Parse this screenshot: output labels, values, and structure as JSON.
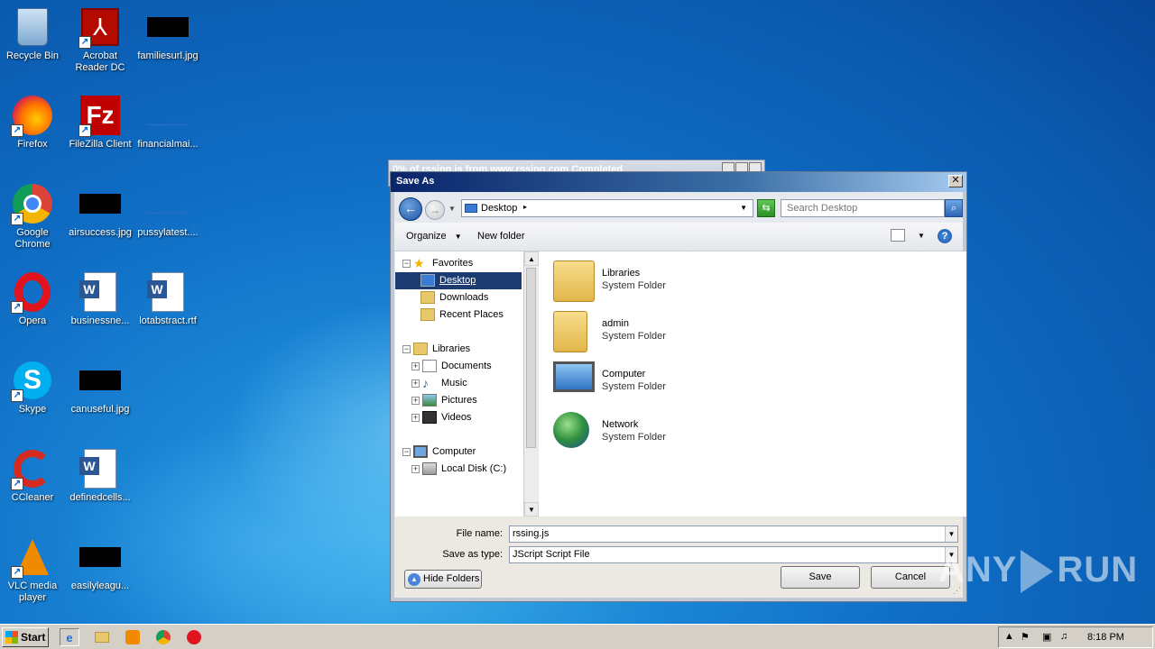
{
  "desktop": {
    "icons": [
      {
        "label": "Recycle Bin",
        "icon": "recycle-bin-icon"
      },
      {
        "label": "Acrobat Reader DC",
        "icon": "acrobat-icon"
      },
      {
        "label": "familiesurl.jpg",
        "icon": "image-file-icon"
      },
      {
        "label": "Firefox",
        "icon": "firefox-icon"
      },
      {
        "label": "FileZilla Client",
        "icon": "filezilla-icon"
      },
      {
        "label": "financialmai...",
        "icon": "image-file-icon"
      },
      {
        "label": "Google Chrome",
        "icon": "chrome-icon"
      },
      {
        "label": "airsuccess.jpg",
        "icon": "image-file-icon"
      },
      {
        "label": "pussylatest....",
        "icon": "image-file-icon"
      },
      {
        "label": "Opera",
        "icon": "opera-icon"
      },
      {
        "label": "businessne...",
        "icon": "word-doc-icon"
      },
      {
        "label": "lotabstract.rtf",
        "icon": "word-doc-icon"
      },
      {
        "label": "Skype",
        "icon": "skype-icon"
      },
      {
        "label": "canuseful.jpg",
        "icon": "image-file-icon"
      },
      {
        "label": "CCleaner",
        "icon": "ccleaner-icon"
      },
      {
        "label": "definedcells...",
        "icon": "word-doc-icon"
      },
      {
        "label": "VLC media player",
        "icon": "vlc-icon"
      },
      {
        "label": "easilyleagu...",
        "icon": "image-file-icon"
      }
    ]
  },
  "back_window": {
    "title": "0% of rssing.js from www.rssing.com Completed"
  },
  "dialog": {
    "title": "Save As",
    "close_glyph": "✕",
    "address": "Desktop",
    "search_placeholder": "Search Desktop",
    "toolbar": {
      "organize": "Organize",
      "new_folder": "New folder",
      "help": "?"
    },
    "nav": {
      "favorites": "Favorites",
      "desktop": "Desktop",
      "downloads": "Downloads",
      "recent": "Recent Places",
      "libraries": "Libraries",
      "documents": "Documents",
      "music": "Music",
      "pictures": "Pictures",
      "videos": "Videos",
      "computer": "Computer",
      "local_disk": "Local Disk (C:)"
    },
    "items": [
      {
        "name": "Libraries",
        "type": "System Folder"
      },
      {
        "name": "admin",
        "type": "System Folder"
      },
      {
        "name": "Computer",
        "type": "System Folder"
      },
      {
        "name": "Network",
        "type": "System Folder"
      }
    ],
    "file_name_label": "File name:",
    "file_name": "rssing.js",
    "save_type_label": "Save as type:",
    "save_type": "JScript Script File",
    "hide_folders": "Hide Folders",
    "save": "Save",
    "cancel": "Cancel"
  },
  "taskbar": {
    "start": "Start",
    "clock": "8:18 PM"
  },
  "watermark": {
    "left": "ANY",
    "right": "RUN"
  }
}
